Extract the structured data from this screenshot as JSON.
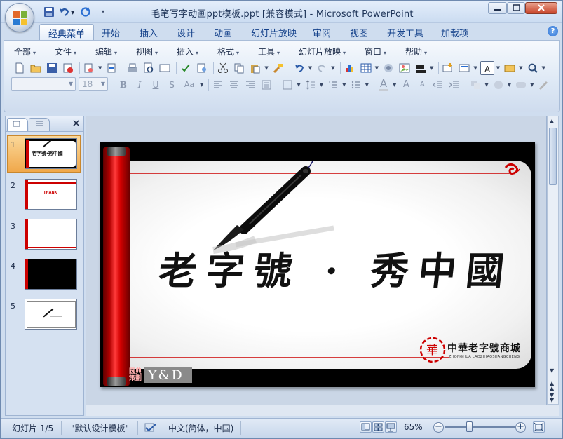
{
  "window": {
    "title": "毛笔写字动画ppt模板.ppt [兼容模式] - Microsoft PowerPoint"
  },
  "ribbon_tabs": [
    "经典菜单",
    "开始",
    "插入",
    "设计",
    "动画",
    "幻灯片放映",
    "审阅",
    "视图",
    "开发工具",
    "加载项"
  ],
  "active_tab": "经典菜单",
  "classic_menu": [
    "全部",
    "文件",
    "编辑",
    "视图",
    "插入",
    "格式",
    "工具",
    "幻灯片放映",
    "窗口",
    "帮助"
  ],
  "toolbar": {
    "font_name": "",
    "font_size": "18",
    "bold": "B",
    "italic": "I",
    "underline": "U",
    "strike": "S",
    "case": "Aa",
    "font_color_label": "A",
    "grow_font": "A",
    "shrink_font": "A"
  },
  "slide_panel": {
    "slides": [
      {
        "number": "1",
        "selected": true
      },
      {
        "number": "2",
        "selected": false
      },
      {
        "number": "3",
        "selected": false
      },
      {
        "number": "4",
        "selected": false
      },
      {
        "number": "5",
        "selected": false
      }
    ],
    "close_glyph": "✕"
  },
  "slide": {
    "calligraphy": "老字號 · 秀中國",
    "corner_tag": "圆典\n策劃",
    "yd_logo": "Y&D",
    "brand_cn": "中華老字號商城",
    "brand_en": "ZHONGHUA LAOZIHAOSHANGCHENG",
    "seal_char": "華"
  },
  "thumb_text": {
    "slide1": "老字號·秀中國",
    "slide2": "THANK"
  },
  "status": {
    "slide_counter": "幻灯片 1/5",
    "theme": "\"默认设计模板\"",
    "language": "中文(简体，中国)",
    "zoom": "65%",
    "zoom_fraction": 0.35
  },
  "colors": {
    "accent_red": "#cc0000",
    "ribbon_blue": "#15428b",
    "selection_orange": "#f0a84b"
  },
  "icons": [
    "office-button-icon",
    "save-icon",
    "undo-icon",
    "redo-icon",
    "help-icon",
    "minimize-icon",
    "maximize-icon",
    "close-icon"
  ]
}
